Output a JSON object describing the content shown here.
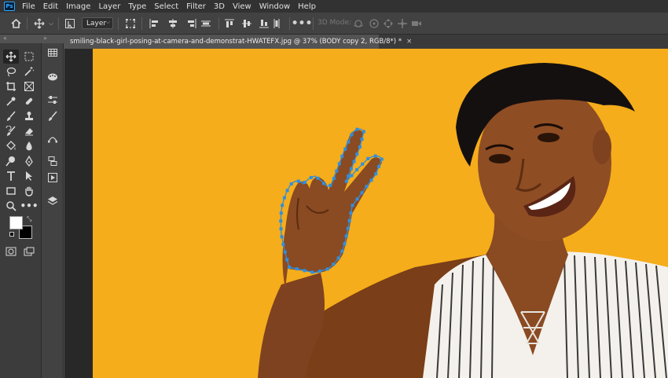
{
  "app": {
    "logo_text": "Ps"
  },
  "menu": [
    "File",
    "Edit",
    "Image",
    "Layer",
    "Type",
    "Select",
    "Filter",
    "3D",
    "View",
    "Window",
    "Help"
  ],
  "options_bar": {
    "layer_select_value": "Layer",
    "mode_3d_label": "3D Mode:"
  },
  "document": {
    "tab_title": "smiling-black-girl-posing-at-camera-and-demonstrat-HWATEFX.jpg @ 37% (BODY copy 2, RGB/8*) *",
    "close_glyph": "×"
  },
  "colors": {
    "ui_dark": "#323232",
    "ui_mid": "#424242",
    "canvas_background": "#f5ad1b",
    "selection_anchor": "#2f8fe0",
    "foreground_color": "#ffffff",
    "background_color": "#000000"
  },
  "tools_left": [
    "move-tool",
    "marquee-tool",
    "lasso-tool",
    "magic-wand-tool",
    "crop-tool",
    "frame-tool",
    "eyedropper-tool",
    "healing-brush-tool",
    "brush-tool",
    "clone-stamp-tool",
    "history-brush-tool",
    "eraser-tool",
    "paint-bucket-tool",
    "blur-tool",
    "dodge-tool",
    "pen-tool",
    "type-tool",
    "path-selection-tool",
    "rectangle-tool",
    "hand-tool",
    "zoom-tool",
    "more-tools"
  ],
  "panel_icons": [
    "swatches-icon",
    "libraries-icon",
    "adjust-icon",
    "brushes-icon",
    "paths-icon",
    "history-icon",
    "actions-icon",
    "layers-icon"
  ]
}
